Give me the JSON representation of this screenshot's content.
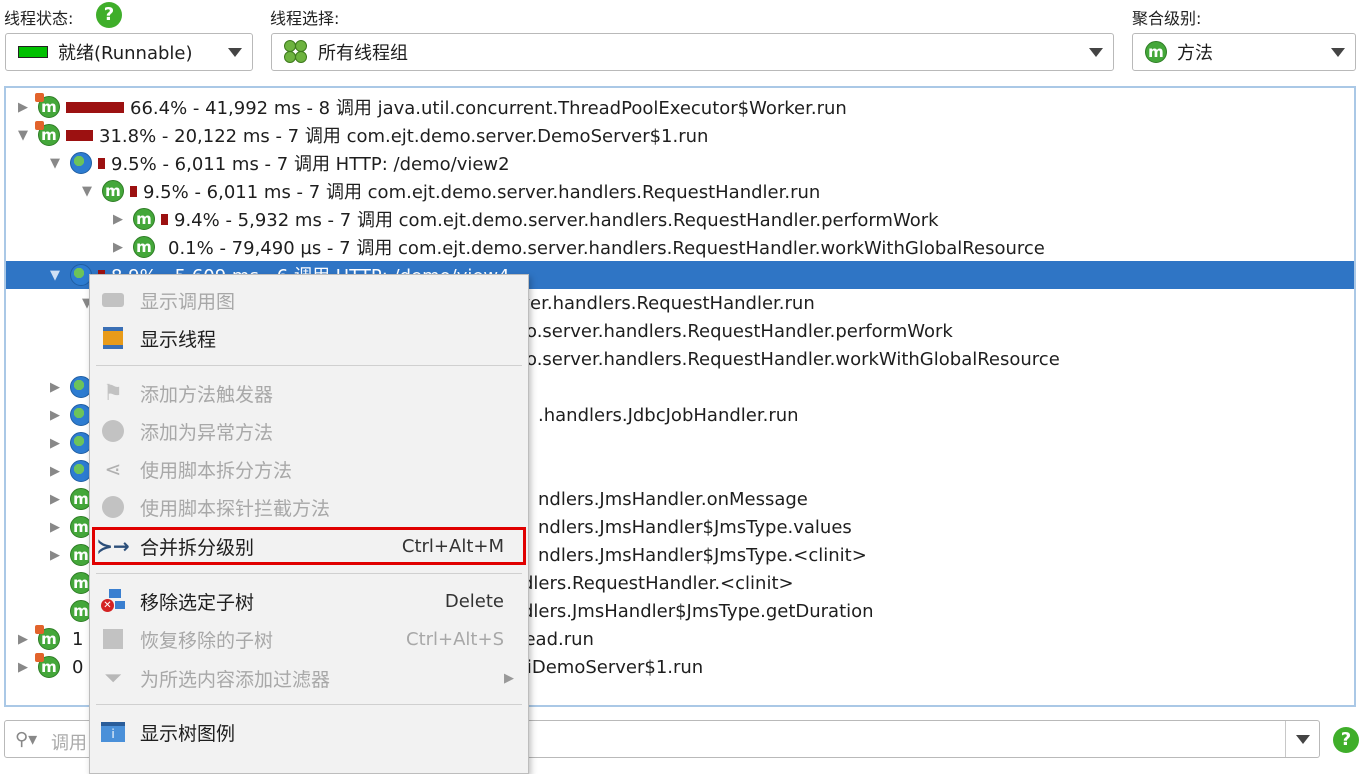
{
  "header": {
    "thread_state_label": "线程状态:",
    "thread_state_value": "就绪(Runnable)",
    "thread_select_label": "线程选择:",
    "thread_select_value": "所有线程组",
    "aggregation_label": "聚合级别:",
    "aggregation_value": "方法",
    "help_glyph": "?"
  },
  "tree": {
    "rows": [
      {
        "text": "66.4% - 41,992 ms - 8 调用 java.util.concurrent.ThreadPoolExecutor$Worker.run"
      },
      {
        "text": "31.8% - 20,122 ms - 7 调用 com.ejt.demo.server.DemoServer$1.run"
      },
      {
        "text": "9.5% - 6,011 ms - 7 调用 HTTP: /demo/view2"
      },
      {
        "text": "9.5% - 6,011 ms - 7 调用 com.ejt.demo.server.handlers.RequestHandler.run"
      },
      {
        "text": "9.4% - 5,932 ms - 7 调用 com.ejt.demo.server.handlers.RequestHandler.performWork"
      },
      {
        "text": "0.1% - 79,490 µs - 7 调用 com.ejt.demo.server.handlers.RequestHandler.workWithGlobalResource"
      },
      {
        "text": "8.9% - 5,609 ms - 6 调用 HTTP: /demo/view4"
      },
      {
        "text": "rver.handlers.RequestHandler.run"
      },
      {
        "text": "o.server.handlers.RequestHandler.performWork"
      },
      {
        "text": "o.server.handlers.RequestHandler.workWithGlobalResource"
      },
      {
        "text": ""
      },
      {
        "text": ".handlers.JdbcJobHandler.run"
      },
      {
        "text": ""
      },
      {
        "text": ""
      },
      {
        "text": "ndlers.JmsHandler.onMessage"
      },
      {
        "text": "ndlers.JmsHandler$JmsType.values"
      },
      {
        "text": "ndlers.JmsHandler$JmsType.<clinit>"
      },
      {
        "text": "dlers.RequestHandler.<clinit>"
      },
      {
        "text": "dlers.JmsHandler$JmsType.getDuration"
      },
      {
        "text": "read.run"
      },
      {
        "text": "uiDemoServer$1.run"
      }
    ],
    "partial_prefix_row19": "1",
    "partial_prefix_row20": "0"
  },
  "context_menu": {
    "items": [
      {
        "label": "显示调用图",
        "accel": "",
        "disabled": true
      },
      {
        "label": "显示线程",
        "accel": "",
        "disabled": false
      },
      {
        "label": "添加方法触发器",
        "accel": "",
        "disabled": true
      },
      {
        "label": "添加为异常方法",
        "accel": "",
        "disabled": true
      },
      {
        "label": "使用脚本拆分方法",
        "accel": "",
        "disabled": true
      },
      {
        "label": "使用脚本探针拦截方法",
        "accel": "",
        "disabled": true
      },
      {
        "label": "合并拆分级别",
        "accel": "Ctrl+Alt+M",
        "disabled": false
      },
      {
        "label": "移除选定子树",
        "accel": "Delete",
        "disabled": false
      },
      {
        "label": "恢复移除的子树",
        "accel": "Ctrl+Alt+S",
        "disabled": true
      },
      {
        "label": "为所选内容添加过滤器",
        "accel": "",
        "disabled": true
      },
      {
        "label": "显示树图例",
        "accel": "",
        "disabled": false
      }
    ]
  },
  "filter": {
    "placeholder": "调用"
  },
  "colors": {
    "selection": "#2f75c5",
    "bar": "#9c1111",
    "highlight_box": "#e00000",
    "runnable_green": "#00c000"
  }
}
